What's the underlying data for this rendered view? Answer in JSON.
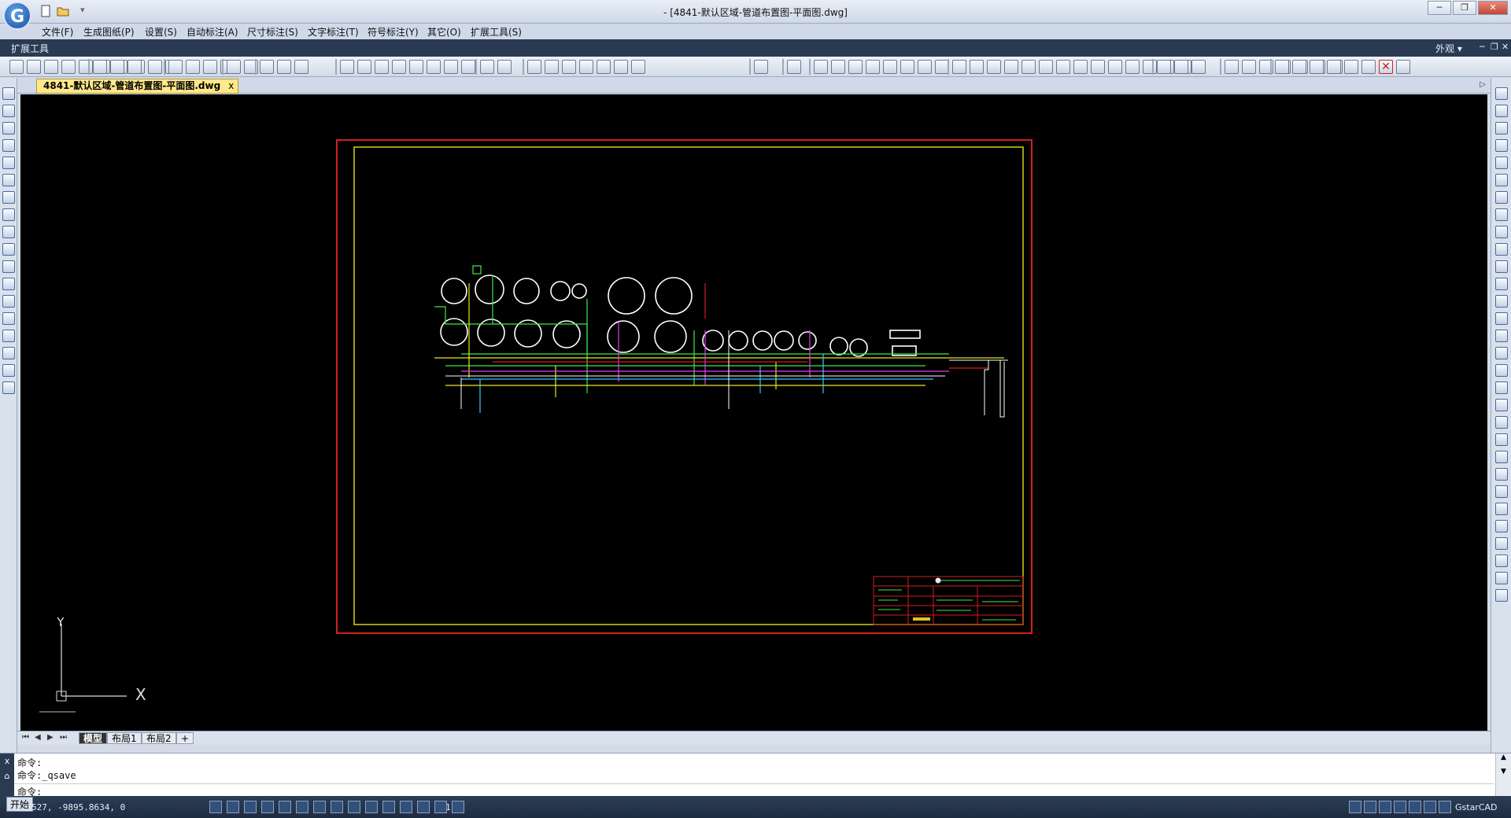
{
  "window": {
    "title": "- [4841-默认区域-管道布置图-平面图.dwg]",
    "app_logo": "G",
    "controls": [
      "minimize",
      "restore",
      "close"
    ]
  },
  "menu": {
    "items": [
      "文件(F)",
      "生成图纸(P)",
      "设置(S)",
      "自动标注(A)",
      "尺寸标注(S)",
      "文字标注(T)",
      "符号标注(Y)",
      "其它(O)",
      "扩展工具(S)"
    ]
  },
  "ribbon_bar": {
    "label": "扩展工具",
    "appearance": "外观",
    "appearance_icon": "chevron-down-icon"
  },
  "document": {
    "tab_label": "4841-默认区域-管道布置图-平面图.dwg",
    "close_glyph": "x"
  },
  "layout_tabs": {
    "tabs": [
      "模型",
      "布局1",
      "布局2",
      "+"
    ],
    "active": "模型"
  },
  "command": {
    "lines": [
      "命令:",
      "命令:_qsave",
      "命令:"
    ],
    "close_glyph": "x"
  },
  "status": {
    "start_label": "开始",
    "coords": "527, -9895.8634, 0",
    "scale": "1:1",
    "product": "GstarCAD"
  },
  "colors": {
    "canvas_bg": "#000000",
    "border_red": "#d21e1e",
    "frame_yellow": "#cfd21e",
    "title_bar": "#2a3a52",
    "doc_tab": "#ffe88a"
  }
}
